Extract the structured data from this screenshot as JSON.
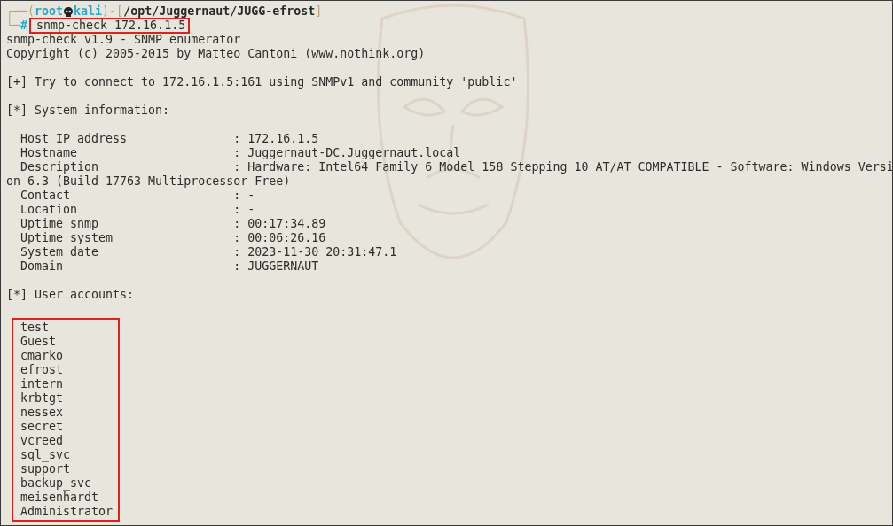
{
  "prompt": {
    "decor": [
      "┌──(",
      ")-[",
      "]",
      "└─"
    ],
    "user": "root",
    "host": "kali",
    "path": "/opt/Juggernaut/JUGG-efrost",
    "symbol": "#",
    "command": "snmp-check 172.16.1.5"
  },
  "output": [
    {
      "kind": "text",
      "text": "snmp-check v1.9 - SNMP enumerator"
    },
    {
      "kind": "text",
      "text": "Copyright (c) 2005-2015 by Matteo Cantoni (www.nothink.org)"
    },
    {
      "kind": "blank"
    },
    {
      "kind": "text",
      "text": "[+] Try to connect to 172.16.1.5:161 using SNMPv1 and community 'public'"
    },
    {
      "kind": "blank"
    },
    {
      "kind": "text",
      "text": "[*] System information:"
    },
    {
      "kind": "blank"
    },
    {
      "kind": "text",
      "text": "  Host IP address               : 172.16.1.5"
    },
    {
      "kind": "text",
      "text": "  Hostname                      : Juggernaut-DC.Juggernaut.local"
    },
    {
      "kind": "text",
      "text": "  Description                   : Hardware: Intel64 Family 6 Model 158 Stepping 10 AT/AT COMPATIBLE - Software: Windows Version 6.3 (Build 17763 Multiprocessor Free)"
    },
    {
      "kind": "text",
      "text": "  Contact                       : -"
    },
    {
      "kind": "text",
      "text": "  Location                      : -"
    },
    {
      "kind": "text",
      "text": "  Uptime snmp                   : 00:17:34.89"
    },
    {
      "kind": "text",
      "text": "  Uptime system                 : 00:06:26.16"
    },
    {
      "kind": "text",
      "text": "  System date                   : 2023-11-30 20:31:47.1"
    },
    {
      "kind": "text",
      "text": "  Domain                        : JUGGERNAUT"
    },
    {
      "kind": "blank"
    },
    {
      "kind": "text",
      "text": "[*] User accounts:"
    },
    {
      "kind": "blank"
    }
  ],
  "user_accounts": [
    "test",
    "Guest",
    "cmarko",
    "efrost",
    "intern",
    "krbtgt",
    "nessex",
    "secret",
    "vcreed",
    "sql_svc",
    "support",
    "backup_svc",
    "meisenhardt",
    "Administrator"
  ]
}
